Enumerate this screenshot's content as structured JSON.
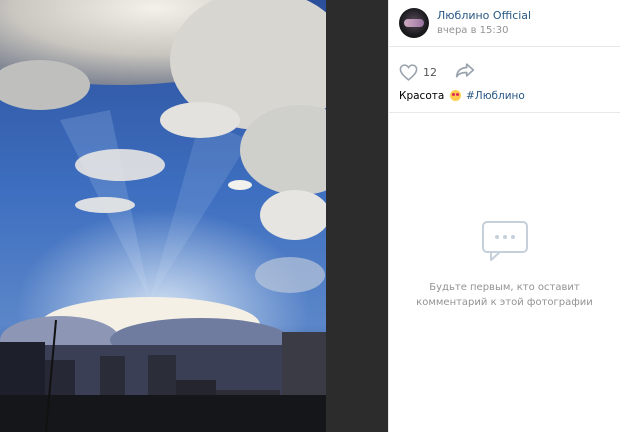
{
  "post": {
    "author": "Люблино Official",
    "date": "вчера в 15:30",
    "likes": "12",
    "caption_text": "Красота",
    "hashtag": "#Люблино"
  },
  "comments": {
    "empty_line1": "Будьте первым, кто оставит",
    "empty_line2": "комментарий к этой фотографии"
  },
  "colors": {
    "link": "#2a5885",
    "muted": "#939393",
    "viewer_bg": "#2c2c2c"
  }
}
